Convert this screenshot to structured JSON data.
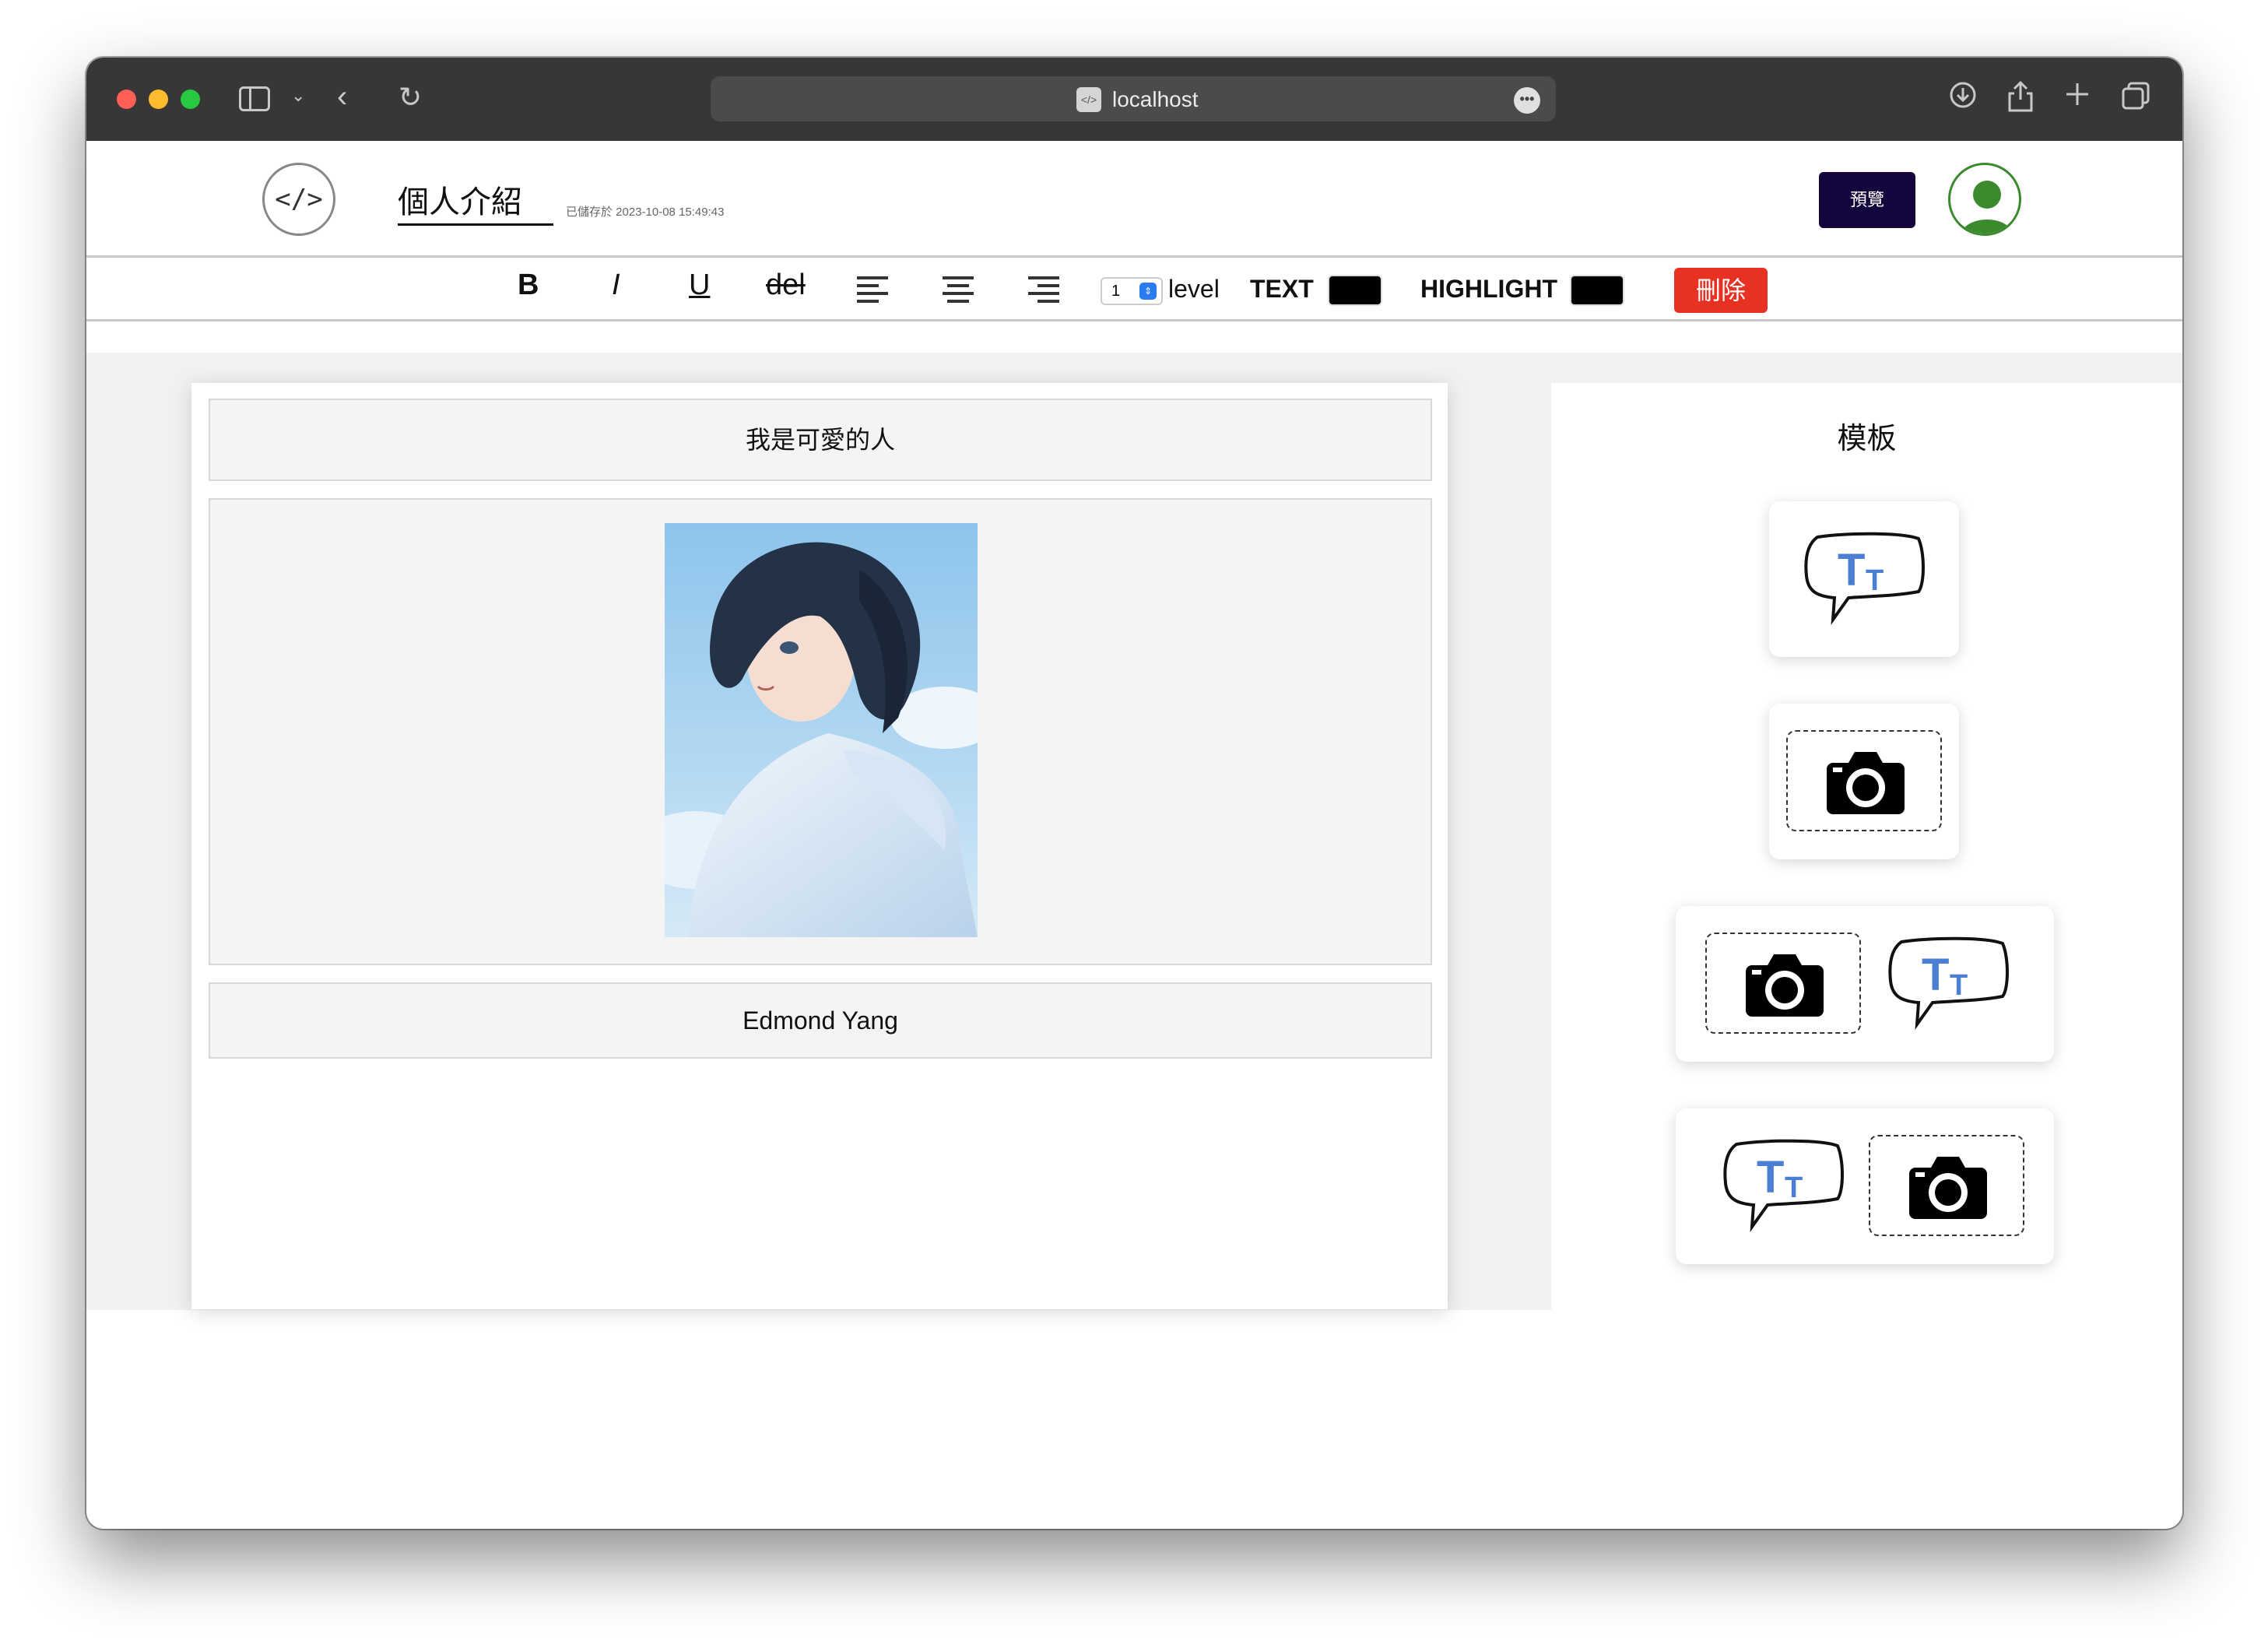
{
  "browser": {
    "url": "localhost"
  },
  "header": {
    "logo_glyph": "</>",
    "doc_title": "個人介紹",
    "saved_at": "已儲存於 2023-10-08 15:49:43",
    "preview_label": "預覽"
  },
  "toolbar": {
    "bold": "B",
    "italic": "I",
    "underline": "U",
    "strike": "del",
    "level_value": "1",
    "level_label": "level",
    "text_label": "TEXT",
    "text_color": "#000000",
    "highlight_label": "HIGHLIGHT",
    "highlight_color": "#000000",
    "delete_label": "刪除"
  },
  "canvas": {
    "blocks": [
      {
        "type": "text",
        "content": "我是可愛的人"
      },
      {
        "type": "image",
        "content": "anime-girl-portrait"
      },
      {
        "type": "text",
        "content": "Edmond Yang"
      }
    ]
  },
  "templates": {
    "title": "模板",
    "items": [
      "text-template",
      "image-template",
      "image-text-template",
      "text-image-template"
    ]
  },
  "colors": {
    "preview_button": "#14063c",
    "delete_button": "#e63123",
    "avatar": "#3b8a2e",
    "template_text_icon": "#4a7fd4"
  }
}
